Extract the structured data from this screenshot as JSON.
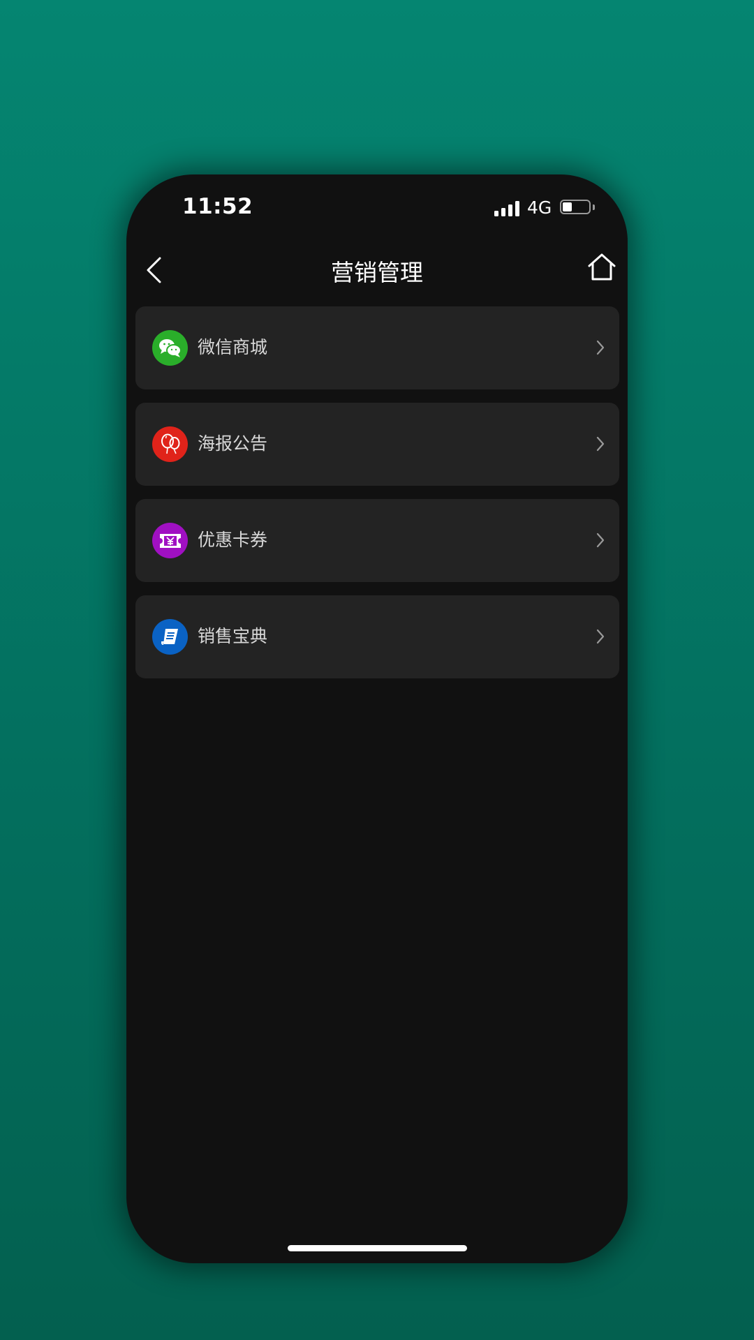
{
  "status_bar": {
    "time": "11:52",
    "network": "4G",
    "signal_bars": 4,
    "battery_level": 0.35
  },
  "header": {
    "title": "营销管理",
    "back_icon": "chevron-left-icon",
    "home_icon": "home-icon"
  },
  "menu": {
    "items": [
      {
        "label": "微信商城",
        "icon": "wechat-icon",
        "icon_color": "#2aae2a"
      },
      {
        "label": "海报公告",
        "icon": "balloon-icon",
        "icon_color": "#e0231a"
      },
      {
        "label": "优惠卡券",
        "icon": "coupon-icon",
        "icon_color": "#a010c2"
      },
      {
        "label": "销售宝典",
        "icon": "book-icon",
        "icon_color": "#0a62c4"
      }
    ]
  },
  "colors": {
    "background": "#058571",
    "phone_screen": "#111111",
    "card": "#232323",
    "text_primary": "#ffffff",
    "text_secondary": "#d8d8d8"
  }
}
